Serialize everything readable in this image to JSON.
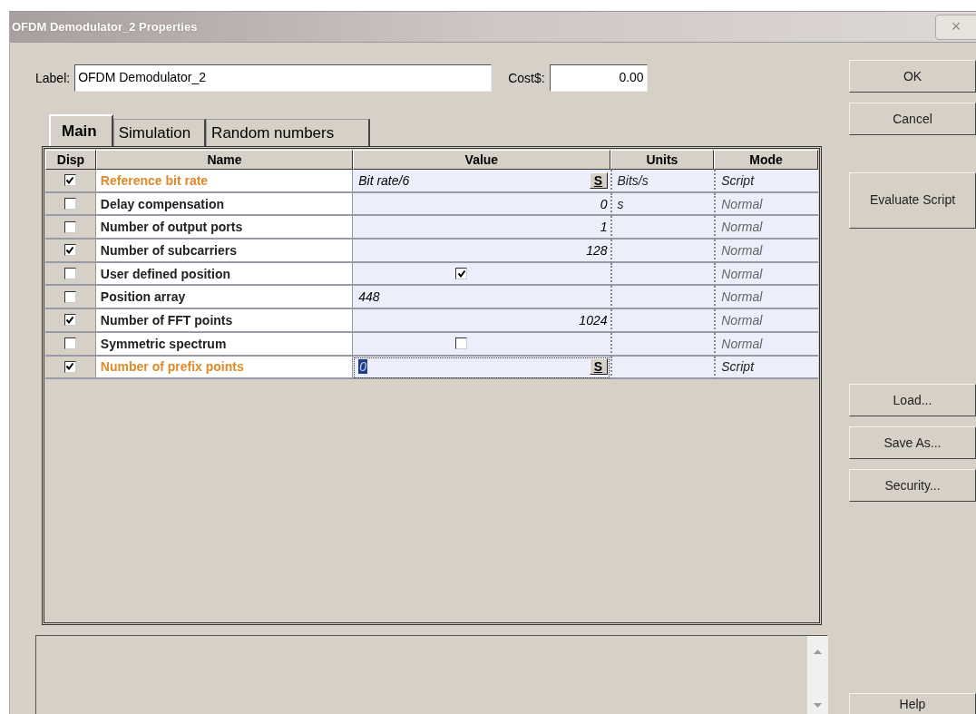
{
  "window": {
    "title": "OFDM Demodulator_2 Properties",
    "close": "×"
  },
  "label": {
    "caption": "Label:",
    "value": "OFDM Demodulator_2"
  },
  "cost": {
    "caption": "Cost$:",
    "value": "0.00"
  },
  "tabs": [
    {
      "label": "Main",
      "selected": true
    },
    {
      "label": "Simulation",
      "selected": false
    },
    {
      "label": "Random numbers",
      "selected": false
    }
  ],
  "table": {
    "columns": [
      "Disp",
      "Name",
      "Value",
      "Units",
      "Mode"
    ],
    "rows": [
      {
        "disp": true,
        "name": "Reference bit rate",
        "script": true,
        "kind": "text",
        "value": "Bit rate/6",
        "script_button": "S",
        "units": "Bits/s",
        "mode": "Script",
        "selected": false
      },
      {
        "disp": false,
        "name": "Delay compensation",
        "script": false,
        "kind": "number",
        "value": "0",
        "units": "s",
        "mode": "Normal",
        "selected": false
      },
      {
        "disp": false,
        "name": "Number of output ports",
        "script": false,
        "kind": "number",
        "value": "1",
        "mode": "Normal",
        "selected": false
      },
      {
        "disp": true,
        "name": "Number of subcarriers",
        "script": false,
        "kind": "number",
        "value": "128",
        "mode": "Normal",
        "selected": false
      },
      {
        "disp": false,
        "name": "User defined position",
        "script": false,
        "kind": "checkbox",
        "checked": true,
        "mode": "Normal",
        "selected": false
      },
      {
        "disp": false,
        "name": "Position array",
        "script": false,
        "kind": "text",
        "value": "448",
        "mode": "Normal",
        "selected": false
      },
      {
        "disp": true,
        "name": "Number of FFT points",
        "script": false,
        "kind": "number",
        "value": "1024",
        "mode": "Normal",
        "selected": false
      },
      {
        "disp": false,
        "name": "Symmetric spectrum",
        "script": false,
        "kind": "checkbox",
        "checked": false,
        "mode": "Normal",
        "selected": false
      },
      {
        "disp": true,
        "name": "Number of prefix points",
        "script": true,
        "kind": "text",
        "value": "0",
        "script_button": "S",
        "mode": "Script",
        "selected": true
      }
    ]
  },
  "buttons_top": [
    "OK",
    "Cancel",
    "Evaluate Script"
  ],
  "buttons_bottom": [
    "Load...",
    "Save As...",
    "Security..."
  ],
  "help": "Help"
}
